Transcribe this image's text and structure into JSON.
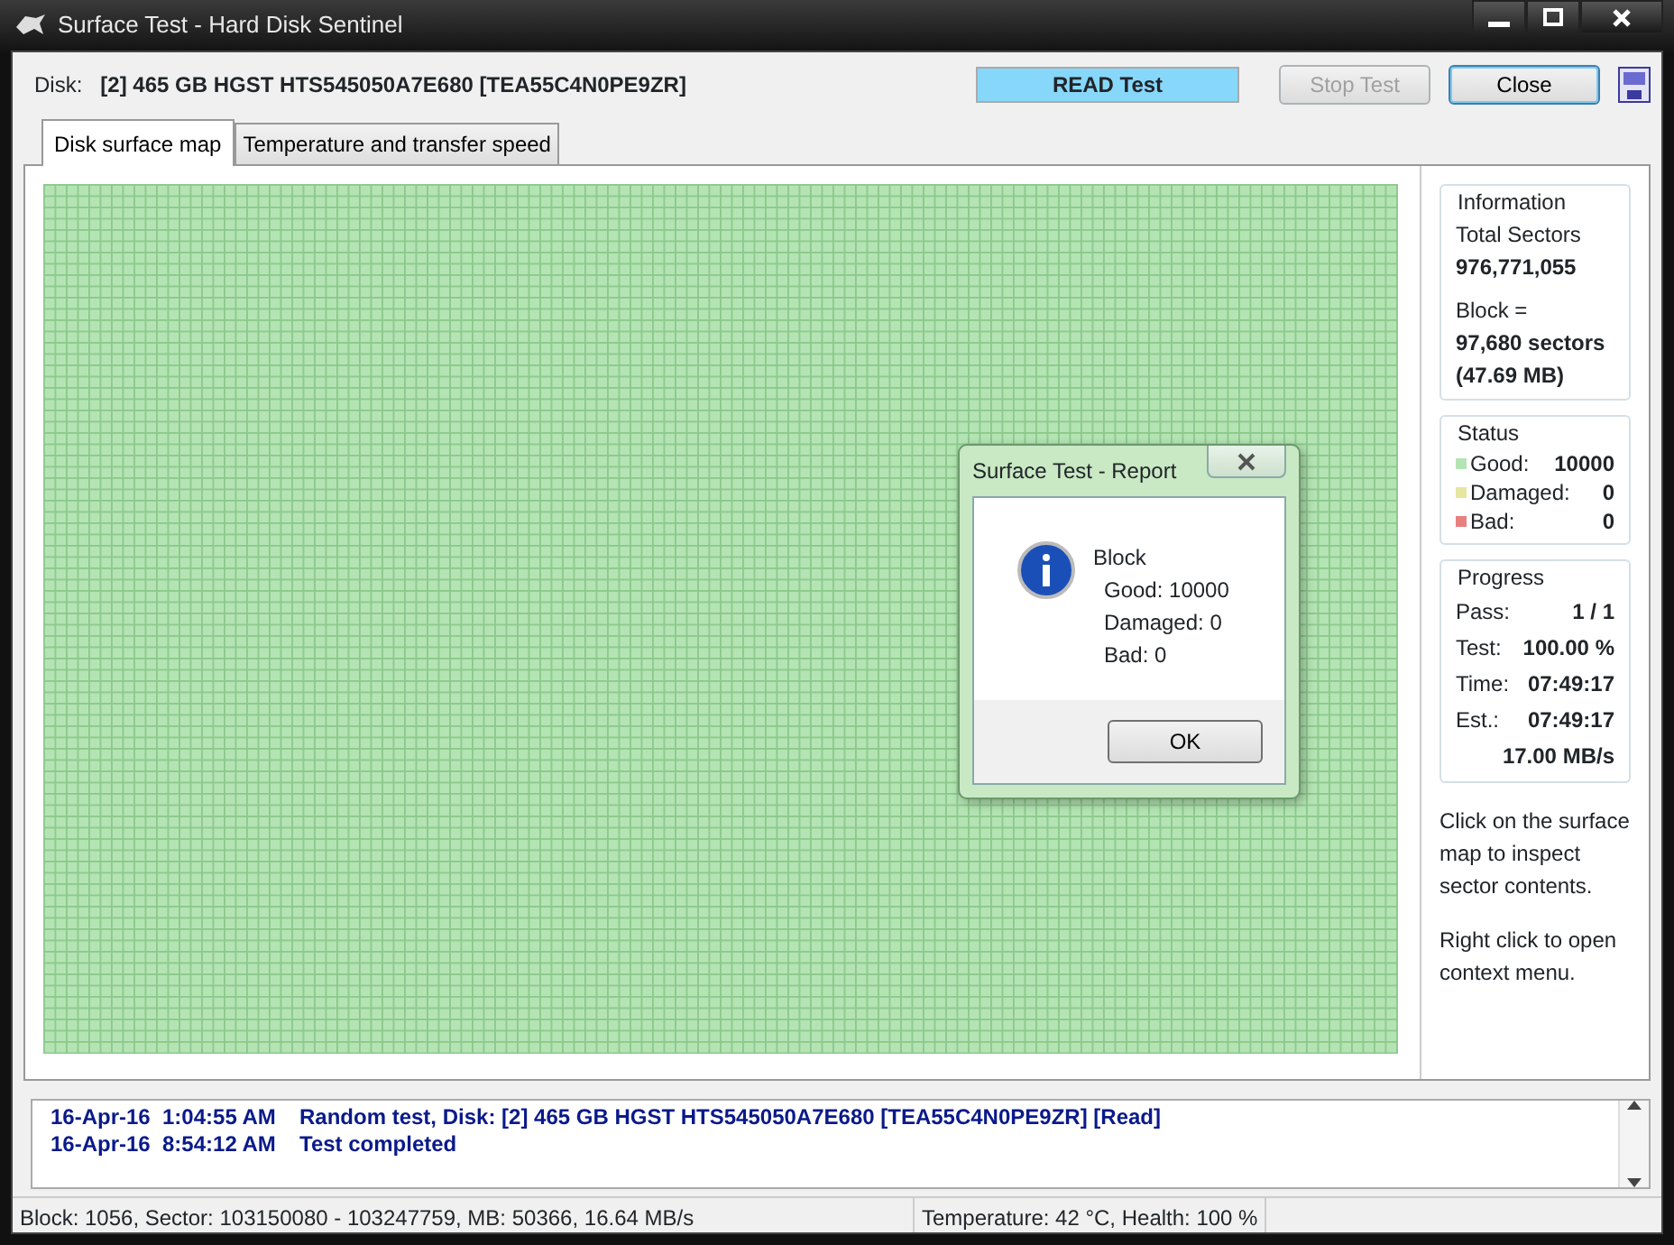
{
  "window": {
    "title": "Surface Test - Hard Disk Sentinel"
  },
  "toolbar": {
    "disk_label": "Disk:",
    "disk": "[2] 465 GB  HGST HTS545050A7E680 [TEA55C4N0PE9ZR]",
    "test_mode": "READ Test",
    "buttons": [
      {
        "label": "Stop Test",
        "disabled": true
      },
      {
        "label": "Close",
        "disabled": false
      }
    ]
  },
  "tabs": [
    {
      "label": "Disk surface map",
      "selected": true
    },
    {
      "label": "Temperature and transfer speed",
      "selected": false
    }
  ],
  "information": {
    "title": "Information",
    "rows": [
      "Total Sectors",
      "976,771,055",
      "Block =",
      "97,680 sectors",
      "(47.69 MB)"
    ]
  },
  "status": {
    "title": "Status",
    "items": [
      {
        "label": "Good:",
        "value": "10000",
        "color": "#b4e4b4"
      },
      {
        "label": "Damaged:",
        "value": "0",
        "color": "#e6e6a0"
      },
      {
        "label": "Bad:",
        "value": "0",
        "color": "#e88080"
      }
    ]
  },
  "progress": {
    "title": "Progress",
    "rows": [
      {
        "label": "Pass:",
        "value": "1 / 1"
      },
      {
        "label": "Test:",
        "value": "100.00 %"
      },
      {
        "label": "Time:",
        "value": "07:49:17"
      },
      {
        "label": "Est.:",
        "value": "07:49:17"
      },
      {
        "label": "",
        "value": "17.00 MB/s"
      }
    ]
  },
  "hints": [
    "Click on the surface map to inspect sector contents.",
    "Right click to open context menu."
  ],
  "dialog": {
    "title": "Surface Test - Report",
    "heading": "Block",
    "lines": [
      "Good: 10000",
      "Damaged: 0",
      "Bad: 0"
    ],
    "button": "OK"
  },
  "log": [
    {
      "date": "16-Apr-16",
      "time": "1:04:55 AM",
      "message": "Random test, Disk: [2] 465 GB  HGST HTS545050A7E680 [TEA55C4N0PE9ZR] [Read]"
    },
    {
      "date": "16-Apr-16",
      "time": "8:54:12 AM",
      "message": "Test completed"
    }
  ],
  "status_bar": [
    "Block: 1056, Sector: 103150080 - 103247759, MB: 50366, 16.64 MB/s",
    "Temperature: 42  °C,  Health: 100 %"
  ]
}
